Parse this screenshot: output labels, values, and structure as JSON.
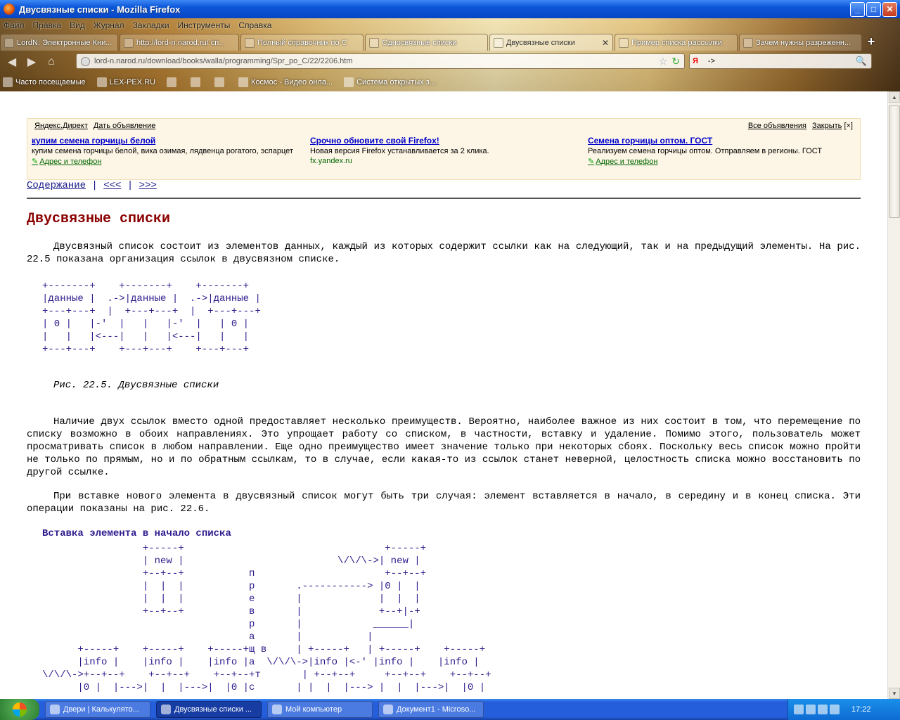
{
  "window": {
    "title": "Двусвязные списки - Mozilla Firefox"
  },
  "menu": [
    "Файл",
    "Правка",
    "Вид",
    "Журнал",
    "Закладки",
    "Инструменты",
    "Справка"
  ],
  "tabs": [
    {
      "label": "LordN: Электронные Кни...",
      "active": false,
      "width": 168
    },
    {
      "label": "http://lord-n.narod.ru/ сп...",
      "active": false,
      "width": 170
    },
    {
      "label": "Полный справочник по С",
      "active": false,
      "width": 175
    },
    {
      "label": "Односвязные списки",
      "active": false,
      "width": 175
    },
    {
      "label": "Двусвязные списки",
      "active": true,
      "width": 176
    },
    {
      "label": "Пример списка рассылки",
      "active": false,
      "width": 175
    },
    {
      "label": "Зачем нужны разреженн...",
      "active": false,
      "width": 175
    }
  ],
  "nav": {
    "url": "lord-n.narod.ru/download/books/walla/programming/Spr_po_C/22/2206.htm",
    "search_value": "->"
  },
  "bookmarks": [
    "Часто посещаемые",
    "LEX-PEX.RU",
    "",
    "",
    "",
    "Космос - Видео онла...",
    "Система открытых з..."
  ],
  "ad": {
    "head": [
      "Яндекс.Директ",
      "Дать объявление"
    ],
    "right": [
      "Все объявления",
      "Закрыть"
    ],
    "close_mark": "[×]",
    "items": [
      {
        "title": "купим семена горчицы белой",
        "desc": "купим семена горчицы белой, вика озимая, лядвенца рогатого, эспарцет",
        "url": "Адрес и телефон",
        "url_link": true
      },
      {
        "title": "Срочно обновите свой Firefox!",
        "desc": "Новая версия Firefox устанавливается за 2 клика.",
        "url": "fx.yandex.ru",
        "url_link": false
      },
      {
        "title": "Семена горчицы оптом. ГОСТ",
        "desc": "Реализуем семена горчицы оптом. Отправляем в регионы. ГОСТ",
        "url": "Адрес и телефон",
        "url_link": true
      }
    ]
  },
  "pagenav": {
    "contents": "Содержание",
    "sep": " | ",
    "prev": "<<<",
    "next": ">>>"
  },
  "article": {
    "title": "Двусвязные списки",
    "p1": "Двусвязный список состоит из элементов данных, каждый из которых содержит ссылки как на следующий, так и на предыдущий элементы. На рис. 22.5 показана организация ссылок в двусвязном списке.",
    "diagram1": "+-------+    +-------+    +-------+\n|данные |  .->|данные |  .->|данные |\n+---+---+  |  +---+---+  |  +---+---+\n| 0 |   |-'  |   |   |-'  |   | 0 |\n|   |   |<---|   |   |<---|   |   |\n+---+---+    +---+---+    +---+---+",
    "caption": "Рис. 22.5. Двусвязные списки",
    "p2": "Наличие двух ссылок вместо одной предоставляет несколько преимуществ. Вероятно, наиболее важное из них состоит в том, что перемещение по списку возможно в обоих направлениях. Это упрощает работу со списком, в частности, вставку и удаление. Помимо этого, пользователь может просматривать список в любом направлении. Еще одно преимущество имеет значение только при некоторых сбоях. Поскольку весь список можно пройти не только по прямым, но и по обратным ссылкам, то в случае, если какая-то из ссылок станет неверной, целостность списка можно восстановить по другой ссылке.",
    "p3": "При вставке нового элемента в двусвязный список могут быть три случая: элемент вставляется в начало, в середину и в конец списка. Эти операции показаны на рис. 22.6.",
    "subhead": "Вставка элемента в начало списка",
    "diagram2": "                 +-----+                                  +-----+\n                 | new |                          \\/\\/\\->| new |\n                 +--+--+           п                      +--+--+\n                 |  |  |           р       .-----------> |0 |  |\n                 |  |  |           е       |             |  |  |\n                 +--+--+           в       |             +--+|-+\n                                   р       |            ______|\n                                   а       |           |\n      +-----+    +-----+    +-----+щ в     | +-----+   | +-----+    +-----+\n      |info |    |info |    |info |а  \\/\\/\\->|info |<-' |info |    |info |\n\\/\\/\\->+--+--+    +--+--+    +--+--+т       | +--+--+     +--+--+    +--+--+\n      |0 |  |--->|  |  |--->|  |0 |с       | |  |  |---> |  |  |--->|  |0 |"
  },
  "taskbar": {
    "items": [
      {
        "label": "Двери | Калькулято...",
        "active": false
      },
      {
        "label": "Двусвязные списки ...",
        "active": true
      },
      {
        "label": "Мой компьютер",
        "active": false
      },
      {
        "label": "Документ1 - Microso...",
        "active": false
      }
    ],
    "lang": "RL",
    "clock": "17:22"
  }
}
